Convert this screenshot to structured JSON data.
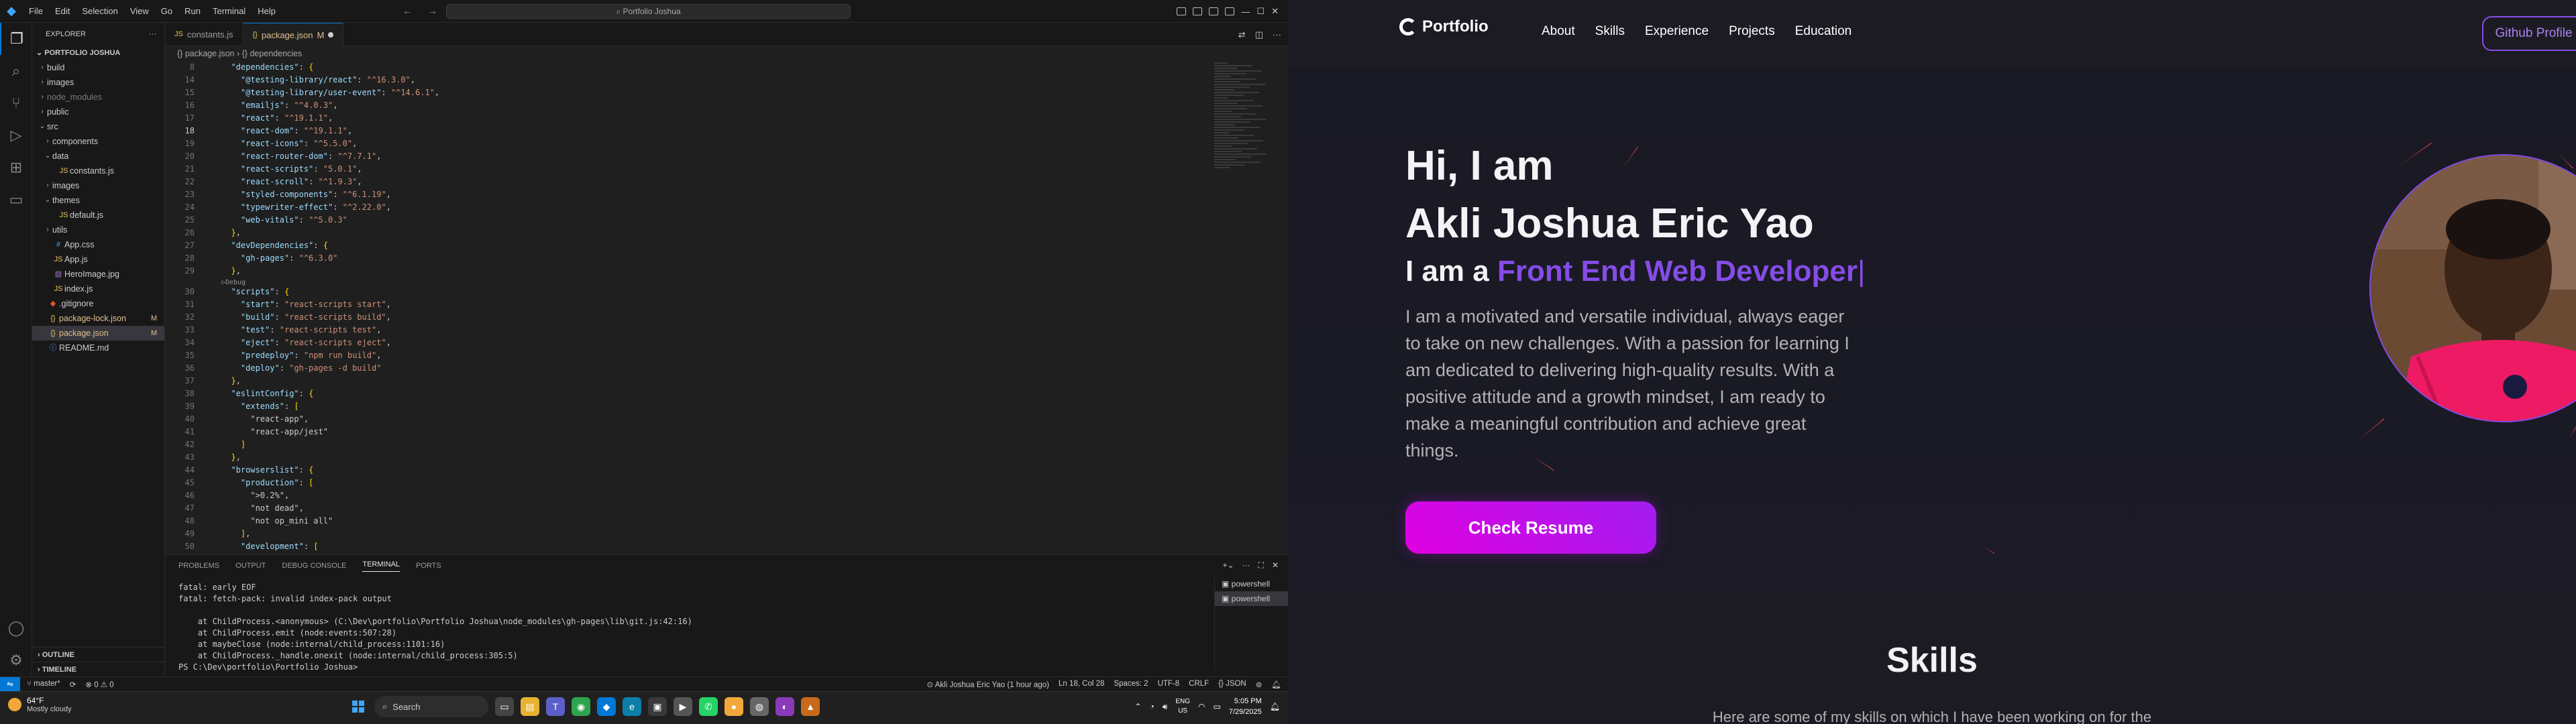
{
  "vscode": {
    "menu": [
      "File",
      "Edit",
      "Selection",
      "View",
      "Go",
      "Run",
      "Terminal",
      "Help"
    ],
    "command_center": "Portfolio Joshua",
    "explorer": {
      "title": "EXPLORER",
      "root": "PORTFOLIO JOSHUA",
      "items": [
        {
          "name": "build",
          "kind": "folder",
          "indent": 1,
          "open": false
        },
        {
          "name": "images",
          "kind": "folder",
          "indent": 1,
          "open": false
        },
        {
          "name": "node_modules",
          "kind": "folder",
          "indent": 1,
          "open": false,
          "dim": true
        },
        {
          "name": "public",
          "kind": "folder",
          "indent": 1,
          "open": false
        },
        {
          "name": "src",
          "kind": "folder",
          "indent": 1,
          "open": true
        },
        {
          "name": "components",
          "kind": "folder",
          "indent": 2,
          "open": false
        },
        {
          "name": "data",
          "kind": "folder",
          "indent": 2,
          "open": true
        },
        {
          "name": "constants.js",
          "kind": "js",
          "indent": 3
        },
        {
          "name": "images",
          "kind": "folder",
          "indent": 2,
          "open": false
        },
        {
          "name": "themes",
          "kind": "folder",
          "indent": 2,
          "open": true
        },
        {
          "name": "default.js",
          "kind": "js",
          "indent": 3
        },
        {
          "name": "utils",
          "kind": "folder",
          "indent": 2,
          "open": false
        },
        {
          "name": "App.css",
          "kind": "css",
          "indent": 2
        },
        {
          "name": "App.js",
          "kind": "js",
          "indent": 2
        },
        {
          "name": "HeroImage.jpg",
          "kind": "img",
          "indent": 2
        },
        {
          "name": "index.js",
          "kind": "js",
          "indent": 2
        },
        {
          "name": ".gitignore",
          "kind": "git",
          "indent": 1
        },
        {
          "name": "package-lock.json",
          "kind": "json",
          "indent": 1,
          "badge": "M"
        },
        {
          "name": "package.json",
          "kind": "json",
          "indent": 1,
          "badge": "M",
          "selected": true
        },
        {
          "name": "README.md",
          "kind": "md",
          "indent": 1
        }
      ],
      "outline": "OUTLINE",
      "timeline": "TIMELINE"
    },
    "tabs": [
      {
        "label": "constants.js",
        "active": false,
        "icon": "JS"
      },
      {
        "label": "package.json",
        "active": true,
        "badge": "M",
        "icon": "{}"
      }
    ],
    "breadcrumb": "{} package.json › {} dependencies",
    "code": [
      {
        "n": "8",
        "t": "  \"dependencies\": {",
        "cls": "b"
      },
      {
        "n": "14",
        "t": "    \"@testing-library/react\": \"^16.3.0\","
      },
      {
        "n": "15",
        "t": "    \"@testing-library/user-event\": \"^14.6.1\","
      },
      {
        "n": "16",
        "t": "    \"emailjs\": \"^4.0.3\","
      },
      {
        "n": "17",
        "t": "    \"react\": \"^19.1.1\","
      },
      {
        "n": "18",
        "t": "    \"react-dom\": \"^19.1.1\",",
        "cur": true
      },
      {
        "n": "19",
        "t": "    \"react-icons\": \"^5.5.0\","
      },
      {
        "n": "20",
        "t": "    \"react-router-dom\": \"^7.7.1\","
      },
      {
        "n": "21",
        "t": "    \"react-scripts\": \"5.0.1\","
      },
      {
        "n": "22",
        "t": "    \"react-scroll\": \"^1.9.3\","
      },
      {
        "n": "23",
        "t": "    \"styled-components\": \"^6.1.19\","
      },
      {
        "n": "24",
        "t": "    \"typewriter-effect\": \"^2.22.0\","
      },
      {
        "n": "25",
        "t": "    \"web-vitals\": \"^5.0.3\""
      },
      {
        "n": "26",
        "t": "  },"
      },
      {
        "n": "27",
        "t": "  \"devDependencies\": {"
      },
      {
        "n": "28",
        "t": "    \"gh-pages\": \"^6.3.0\""
      },
      {
        "n": "29",
        "t": "  },"
      },
      {
        "lens": "▷Debug"
      },
      {
        "n": "30",
        "t": "  \"scripts\": {"
      },
      {
        "n": "31",
        "t": "    \"start\": \"react-scripts start\","
      },
      {
        "n": "32",
        "t": "    \"build\": \"react-scripts build\","
      },
      {
        "n": "33",
        "t": "    \"test\": \"react-scripts test\","
      },
      {
        "n": "34",
        "t": "    \"eject\": \"react-scripts eject\","
      },
      {
        "n": "35",
        "t": "    \"predeploy\": \"npm run build\","
      },
      {
        "n": "36",
        "t": "    \"deploy\": \"gh-pages -d build\""
      },
      {
        "n": "37",
        "t": "  },"
      },
      {
        "n": "38",
        "t": "  \"eslintConfig\": {"
      },
      {
        "n": "39",
        "t": "    \"extends\": ["
      },
      {
        "n": "40",
        "t": "      \"react-app\","
      },
      {
        "n": "41",
        "t": "      \"react-app/jest\""
      },
      {
        "n": "42",
        "t": "    ]"
      },
      {
        "n": "43",
        "t": "  },"
      },
      {
        "n": "44",
        "t": "  \"browserslist\": {"
      },
      {
        "n": "45",
        "t": "    \"production\": ["
      },
      {
        "n": "46",
        "t": "      \">0.2%\","
      },
      {
        "n": "47",
        "t": "      \"not dead\","
      },
      {
        "n": "48",
        "t": "      \"not op_mini all\""
      },
      {
        "n": "49",
        "t": "    ],"
      },
      {
        "n": "50",
        "t": "    \"development\": ["
      }
    ],
    "panel": {
      "tabs": [
        {
          "label": "PROBLEMS",
          "active": false
        },
        {
          "label": "OUTPUT",
          "active": false
        },
        {
          "label": "DEBUG CONSOLE",
          "active": false
        },
        {
          "label": "TERMINAL",
          "active": true
        },
        {
          "label": "PORTS",
          "active": false
        }
      ],
      "terminal": "fatal: early EOF\nfatal: fetch-pack: invalid index-pack output\n\n    at ChildProcess.<anonymous> (C:\\Dev\\portfolio\\Portfolio Joshua\\node_modules\\gh-pages\\lib\\git.js:42:16)\n    at ChildProcess.emit (node:events:507:28)\n    at maybeClose (node:internal/child_process:1101:16)\n    at ChildProcess._handle.onexit (node:internal/child_process:305:5)\nPS C:\\Dev\\portfolio\\Portfolio Joshua> ",
      "terminals": [
        "powershell",
        "powershell"
      ]
    },
    "status": {
      "branch": "master*",
      "problems": "⊗ 0 ⚠ 0",
      "author": "Akli Joshua Eric Yao (1 hour ago)",
      "cursor": "Ln 18, Col 28",
      "spaces": "Spaces: 2",
      "encoding": "UTF-8",
      "eol": "CRLF",
      "lang": "{} JSON"
    }
  },
  "taskbar": {
    "weather_temp": "64°F",
    "weather_desc": "Mostly cloudy",
    "search": "Search",
    "lang1": "ENG",
    "lang2": "US",
    "time": "5:05 PM",
    "date": "7/29/2025"
  },
  "site": {
    "logo": "Portfolio",
    "nav": [
      "About",
      "Skills",
      "Experience",
      "Projects",
      "Education"
    ],
    "github": "Github Profile",
    "greeting_line1": "Hi, I am",
    "name": "Akli Joshua Eric Yao",
    "role_prefix": "I am a",
    "role_typed": "Front End Web Developer",
    "description": "I am a motivated and versatile individual, always eager to take on new challenges. With a passion for learning I am dedicated to delivering high-quality results. With a positive attitude and a growth mindset, I am ready to make a meaningful contribution and achieve great things.",
    "resume_btn": "Check Resume",
    "skills_title": "Skills",
    "skills_sub": "Here are some of my skills on which I have been working on for the",
    "accent": "#854ce6"
  }
}
